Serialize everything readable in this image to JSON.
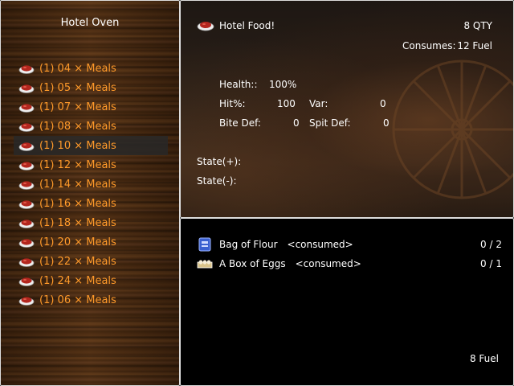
{
  "oven": {
    "title": "Hotel Oven",
    "recipes": [
      {
        "label": "(1) 04 × Meals"
      },
      {
        "label": "(1) 05 × Meals"
      },
      {
        "label": "(1) 07 × Meals"
      },
      {
        "label": "(1) 08 × Meals"
      },
      {
        "label": "(1) 10 × Meals",
        "selected": true
      },
      {
        "label": "(1) 12 × Meals"
      },
      {
        "label": "(1) 14 × Meals"
      },
      {
        "label": "(1) 16 × Meals"
      },
      {
        "label": "(1) 18 × Meals"
      },
      {
        "label": "(1) 20 × Meals"
      },
      {
        "label": "(1) 22 × Meals"
      },
      {
        "label": "(1) 24 × Meals"
      },
      {
        "label": "(1) 06 × Meals"
      }
    ]
  },
  "detail": {
    "item_name": "Hotel Food!",
    "qty": "8 QTY",
    "consumes_label": "Consumes:",
    "consumes_value": "12 Fuel",
    "health_label": "Health::",
    "health_value": "100%",
    "hit_label": "Hit%:",
    "hit_value": "100",
    "var_label": "Var:",
    "var_value": "0",
    "bite_label": "Bite Def:",
    "bite_value": "0",
    "spit_label": "Spit Def:",
    "spit_value": "0",
    "state_plus_label": "State(+):",
    "state_minus_label": "State(-):"
  },
  "ingredients": {
    "items": [
      {
        "name": "Bag of Flour",
        "status": "<consumed>",
        "count": "0 / 2",
        "icon": "flour-bag-icon"
      },
      {
        "name": "A Box of Eggs",
        "status": "<consumed>",
        "count": "0 / 1",
        "icon": "egg-box-icon"
      }
    ],
    "fuel_total": "8 Fuel"
  },
  "colors": {
    "recipe_text": "#ff9a2a",
    "selected_row": "#282828",
    "panel_border": "#dddddd"
  }
}
